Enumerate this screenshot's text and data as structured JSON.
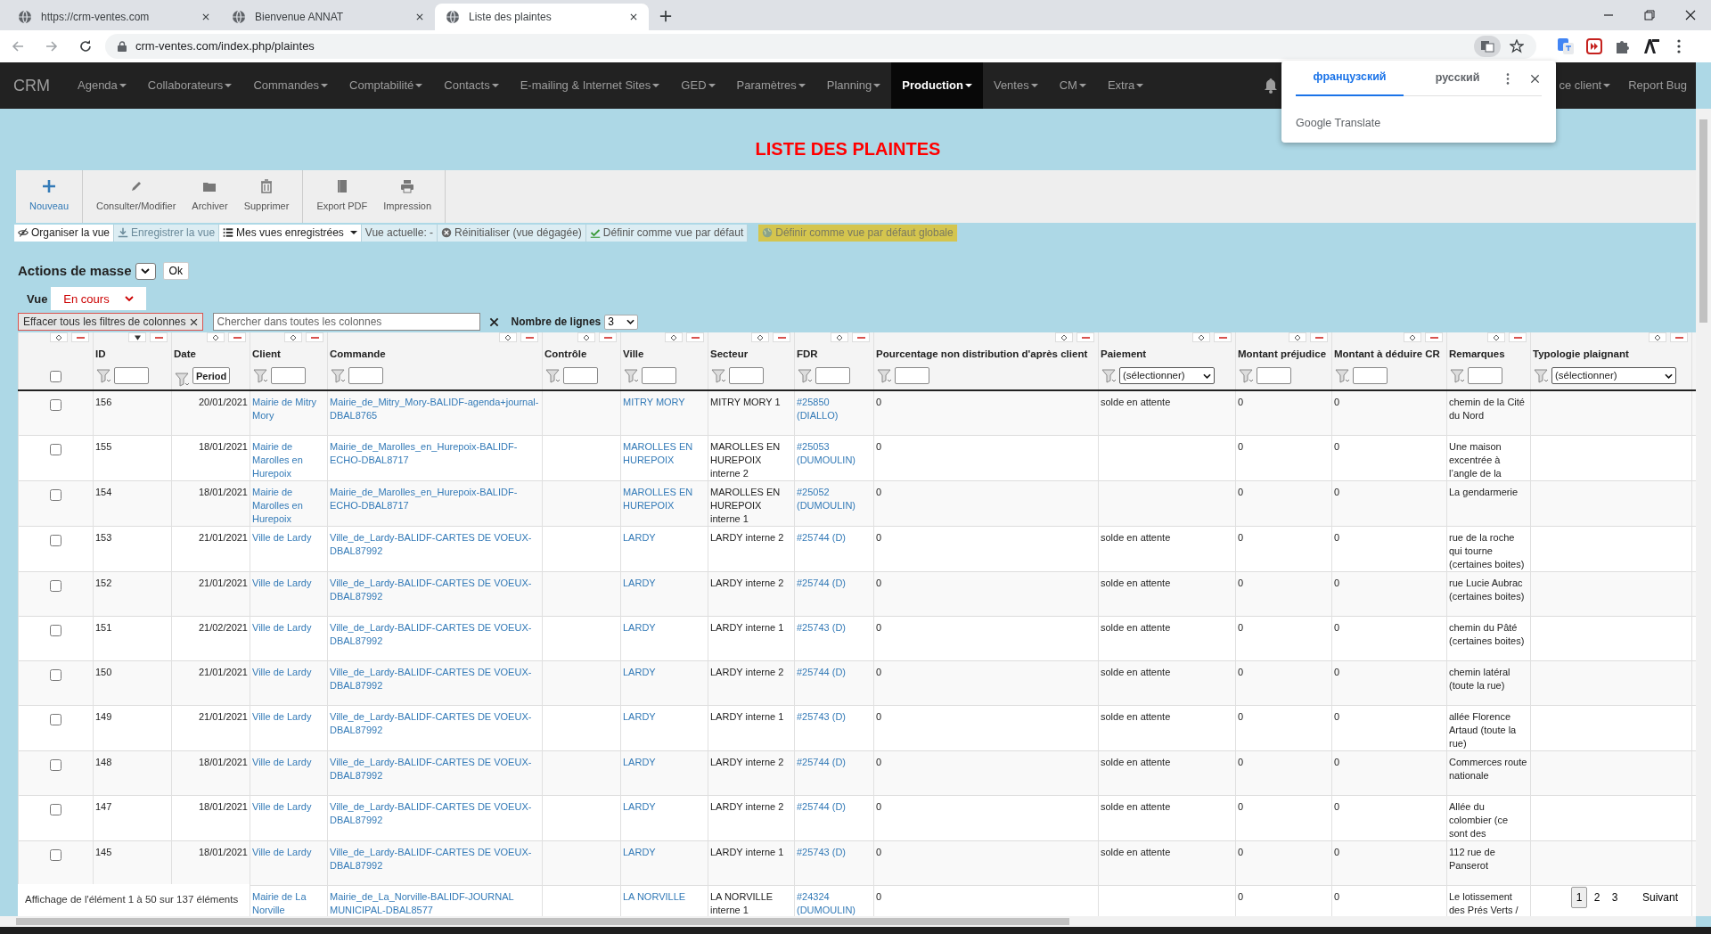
{
  "browser": {
    "tabs": [
      {
        "title": "https://crm-ventes.com",
        "selected": false
      },
      {
        "title": "Bienvenue ANNAT",
        "selected": false
      },
      {
        "title": "Liste des plaintes",
        "selected": true
      }
    ],
    "url": "crm-ventes.com/index.php/plaintes"
  },
  "translate_popup": {
    "languages": [
      {
        "label": "французский",
        "selected": true
      },
      {
        "label": "русский",
        "selected": false
      }
    ],
    "footer": "Google Translate"
  },
  "navbar": {
    "brand": "CRM",
    "items": [
      {
        "label": "Agenda",
        "selected": false
      },
      {
        "label": "Collaborateurs",
        "selected": false
      },
      {
        "label": "Commandes",
        "selected": false
      },
      {
        "label": "Comptabilité",
        "selected": false
      },
      {
        "label": "Contacts",
        "selected": false
      },
      {
        "label": "E-mailing & Internet Sites",
        "selected": false
      },
      {
        "label": "GED",
        "selected": false
      },
      {
        "label": "Paramètres",
        "selected": false
      },
      {
        "label": "Planning",
        "selected": false
      },
      {
        "label": "Production",
        "selected": true
      },
      {
        "label": "Ventes",
        "selected": false
      },
      {
        "label": "CM",
        "selected": false
      },
      {
        "label": "Extra",
        "selected": false
      }
    ],
    "right_items": [
      {
        "label": "ce client",
        "dropdown": true
      },
      {
        "label": "Report Bug",
        "dropdown": false
      }
    ]
  },
  "page_title": "LISTE DES PLAINTES",
  "toolbar": [
    [
      {
        "label": "Nouveau",
        "primary": true
      }
    ],
    [
      {
        "label": "Consulter/Modifier",
        "primary": false
      },
      {
        "label": "Archiver",
        "primary": false
      },
      {
        "label": "Supprimer",
        "primary": false
      }
    ],
    [
      {
        "label": "Export PDF",
        "primary": false
      },
      {
        "label": "Impression",
        "primary": false
      }
    ]
  ],
  "view_bar": [
    {
      "label": "Organiser la vue",
      "kind": "button"
    },
    {
      "label": "Enregistrer la vue",
      "kind": "disabled"
    },
    {
      "label": "Mes vues enregistrées",
      "kind": "dropdown"
    },
    {
      "label": "Vue actuelle: -",
      "kind": "info"
    },
    {
      "label": "Réinitialiser (vue dégagée)",
      "kind": "info"
    },
    {
      "label": "Définir comme vue par défaut",
      "kind": "info"
    },
    {
      "label": "Définir comme vue par défaut globale",
      "kind": "warning"
    }
  ],
  "mass_actions": {
    "label": "Actions de masse",
    "button": "Ok"
  },
  "view_select": {
    "label": "Vue",
    "value": "En cours"
  },
  "filters": {
    "clear_button": "Effacer tous les filtres de colonnes",
    "search_placeholder": "Chercher dans toutes les colonnes",
    "rows_label": "Nombre de lignes",
    "rows_value": "3"
  },
  "table": {
    "select_all": {
      "checked": false,
      "sorted": false
    },
    "columns": [
      {
        "label": "ID",
        "sorted": true,
        "kind": "text",
        "link": false
      },
      {
        "label": "Date",
        "sorted": false,
        "kind": "date",
        "filter_label": "Period",
        "link": false
      },
      {
        "label": "Client",
        "sorted": false,
        "kind": "text",
        "link": true
      },
      {
        "label": "Commande",
        "sorted": false,
        "kind": "text",
        "link": true
      },
      {
        "label": "Contrôle",
        "sorted": false,
        "kind": "text"
      },
      {
        "label": "Ville",
        "sorted": false,
        "kind": "text",
        "link": true
      },
      {
        "label": "Secteur",
        "sorted": false,
        "kind": "text",
        "link": false
      },
      {
        "label": "FDR",
        "sorted": false,
        "kind": "text",
        "link": true
      },
      {
        "label": "Pourcentage non distribution d'après client",
        "sorted": false,
        "kind": "text",
        "link": false
      },
      {
        "label": "Paiement",
        "sorted": false,
        "kind": "select",
        "filter_label": "(sélectionner)",
        "link": false
      },
      {
        "label": "Montant préjudice",
        "sorted": false,
        "kind": "text",
        "link": false
      },
      {
        "label": "Montant à déduire CR",
        "sorted": false,
        "kind": "text",
        "link": false
      },
      {
        "label": "Remarques",
        "sorted": false,
        "kind": "text",
        "link": false
      },
      {
        "label": "Typologie plaignant",
        "sorted": false,
        "kind": "select",
        "filter_label": "(sélectionner)"
      }
    ],
    "rows": [
      {
        "checked": false,
        "cells": [
          "156",
          "20/01/2021",
          "Mairie de Mitry Mory",
          "Mairie_de_Mitry_Mory-BALIDF-agenda+journal-DBAL8765",
          null,
          "MITRY MORY",
          "MITRY MORY 1",
          "#25850 (DIALLO)",
          "0",
          "solde en attente",
          "0",
          "0",
          "chemin de la Cité du Nord",
          null
        ]
      },
      {
        "checked": false,
        "cells": [
          "155",
          "18/01/2021",
          "Mairie de Marolles en Hurepoix",
          "Mairie_de_Marolles_en_Hurepoix-BALIDF-ECHO-DBAL8717",
          null,
          "MAROLLES EN HUREPOIX",
          "MAROLLES EN HUREPOIX interne 2",
          "#25053 (DUMOULIN)",
          "0",
          null,
          "0",
          "0",
          "Une maison excentrée à l’angle de la",
          null
        ]
      },
      {
        "checked": false,
        "cells": [
          "154",
          "18/01/2021",
          "Mairie de Marolles en Hurepoix",
          "Mairie_de_Marolles_en_Hurepoix-BALIDF-ECHO-DBAL8717",
          null,
          "MAROLLES EN HUREPOIX",
          "MAROLLES EN HUREPOIX interne 1",
          "#25052 (DUMOULIN)",
          "0",
          null,
          "0",
          "0",
          "La gendarmerie",
          null
        ]
      },
      {
        "checked": false,
        "cells": [
          "153",
          "21/01/2021",
          "Ville de Lardy",
          "Ville_de_Lardy-BALIDF-CARTES DE VOEUX-DBAL87992",
          null,
          "LARDY",
          "LARDY interne 2",
          "#25744 (D)",
          "0",
          "solde en attente",
          "0",
          "0",
          "rue de la roche qui tourne (certaines boites)",
          null
        ]
      },
      {
        "checked": false,
        "cells": [
          "152",
          "21/01/2021",
          "Ville de Lardy",
          "Ville_de_Lardy-BALIDF-CARTES DE VOEUX-DBAL87992",
          null,
          "LARDY",
          "LARDY interne 2",
          "#25744 (D)",
          "0",
          "solde en attente",
          "0",
          "0",
          "rue Lucie Aubrac (certaines boites)",
          null
        ]
      },
      {
        "checked": false,
        "cells": [
          "151",
          "21/02/2021",
          "Ville de Lardy",
          "Ville_de_Lardy-BALIDF-CARTES DE VOEUX-DBAL87992",
          null,
          "LARDY",
          "LARDY interne 1",
          "#25743 (D)",
          "0",
          "solde en attente",
          "0",
          "0",
          "chemin du Pâté (certaines boites)",
          null
        ]
      },
      {
        "checked": false,
        "cells": [
          "150",
          "21/01/2021",
          "Ville de Lardy",
          "Ville_de_Lardy-BALIDF-CARTES DE VOEUX-DBAL87992",
          null,
          "LARDY",
          "LARDY interne 2",
          "#25744 (D)",
          "0",
          "solde en attente",
          "0",
          "0",
          "chemin latéral (toute la rue)",
          null
        ]
      },
      {
        "checked": false,
        "cells": [
          "149",
          "21/01/2021",
          "Ville de Lardy",
          "Ville_de_Lardy-BALIDF-CARTES DE VOEUX-DBAL87992",
          null,
          "LARDY",
          "LARDY interne 1",
          "#25743 (D)",
          "0",
          "solde en attente",
          "0",
          "0",
          "allée Florence Artaud (toute la rue)",
          null
        ]
      },
      {
        "checked": false,
        "cells": [
          "148",
          "18/01/2021",
          "Ville de Lardy",
          "Ville_de_Lardy-BALIDF-CARTES DE VOEUX-DBAL87992",
          null,
          "LARDY",
          "LARDY interne 2",
          "#25744 (D)",
          "0",
          "solde en attente",
          "0",
          "0",
          "Commerces route nationale",
          null
        ]
      },
      {
        "checked": false,
        "cells": [
          "147",
          "18/01/2021",
          "Ville de Lardy",
          "Ville_de_Lardy-BALIDF-CARTES DE VOEUX-DBAL87992",
          null,
          "LARDY",
          "LARDY interne 2",
          "#25744 (D)",
          "0",
          "solde en attente",
          "0",
          "0",
          "Allée du colombier (ce sont des",
          null
        ]
      },
      {
        "checked": false,
        "cells": [
          "145",
          "18/01/2021",
          "Ville de Lardy",
          "Ville_de_Lardy-BALIDF-CARTES DE VOEUX-DBAL87992",
          null,
          "LARDY",
          "LARDY interne 1",
          "#25743 (D)",
          "0",
          "solde en attente",
          "0",
          "0",
          "112 rue de Panserot",
          null
        ]
      },
      {
        "cells": [
          null,
          null,
          "Mairie de La Norville",
          "Mairie_de_La_Norville-BALIDF-JOURNAL MUNICIPAL-DBAL8577",
          null,
          "LA NORVILLE",
          "LA NORVILLE interne 1",
          "#24324 (DUMOULIN)",
          "0",
          null,
          "0",
          "0",
          "Le lotissement des Prés Verts /",
          null
        ]
      }
    ]
  },
  "footer": {
    "info": "Affichage de l'élément 1 à 50 sur 137 éléments",
    "pages": [
      {
        "label": "1",
        "selected": true
      },
      {
        "label": "2",
        "selected": false
      },
      {
        "label": "3",
        "selected": false
      }
    ],
    "next": "Suivant"
  }
}
